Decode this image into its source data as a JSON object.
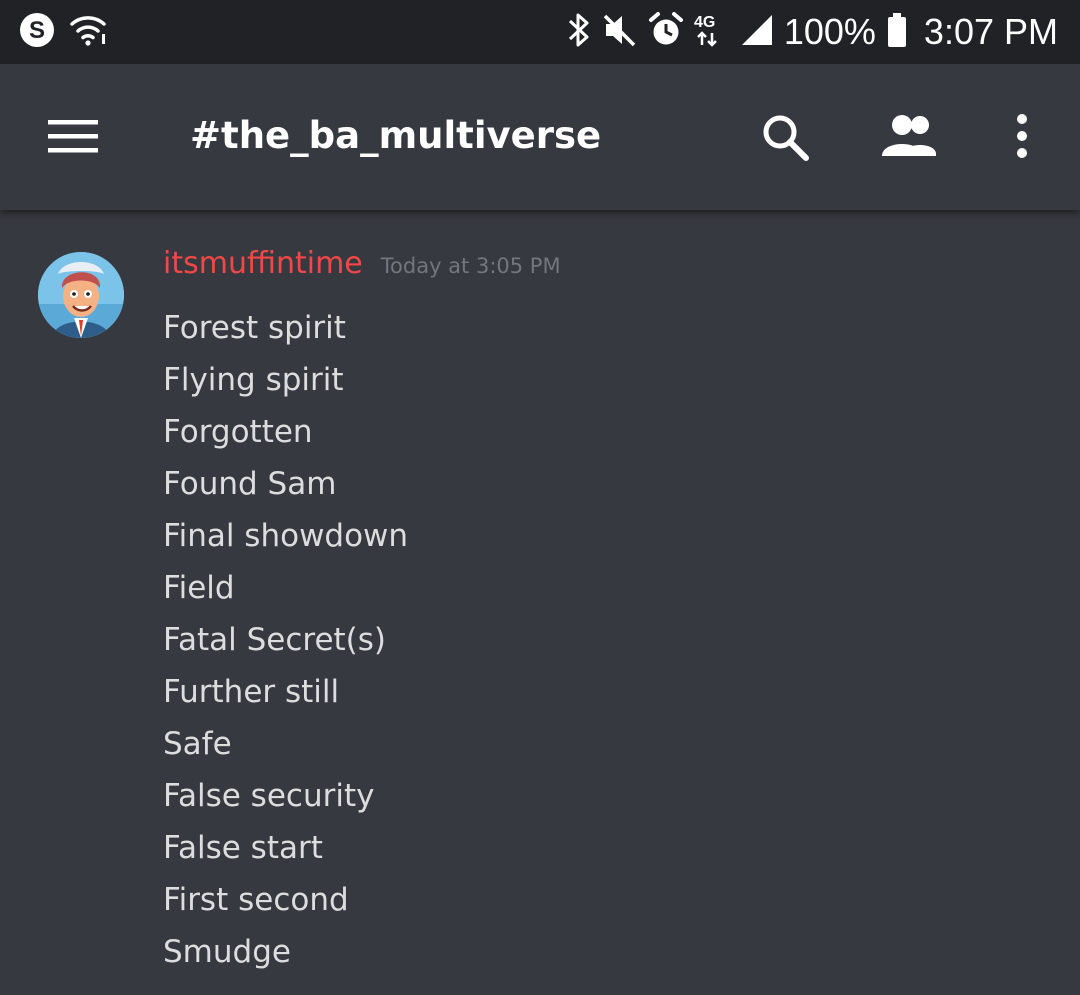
{
  "status_bar": {
    "icons_left": [
      "skype-icon",
      "wifi-icon"
    ],
    "icons_right": [
      "bluetooth-icon",
      "mute-icon",
      "alarm-icon",
      "lte-icon",
      "signal-icon",
      "battery-icon"
    ],
    "network_label": "4G",
    "battery_percent": "100%",
    "time": "3:07 PM"
  },
  "app_bar": {
    "menu_icon": "hamburger-menu-icon",
    "channel_name": "#the_ba_multiverse",
    "search_icon": "search-icon",
    "members_icon": "members-icon",
    "overflow_icon": "more-vert-icon"
  },
  "message": {
    "author": "itsmuffintime",
    "timestamp": "Today at 3:05 PM",
    "author_color": "#f04747",
    "lines": [
      "Forest spirit",
      "Flying spirit",
      "Forgotten",
      "Found Sam",
      "Final showdown",
      "Field",
      "Fatal Secret(s)",
      "Further still",
      "Safe",
      "False security",
      "False start",
      "First second",
      "Smudge"
    ]
  },
  "colors": {
    "background": "#36393f",
    "status_bar": "#202225",
    "text": "#dcddde",
    "muted": "#72767d"
  }
}
